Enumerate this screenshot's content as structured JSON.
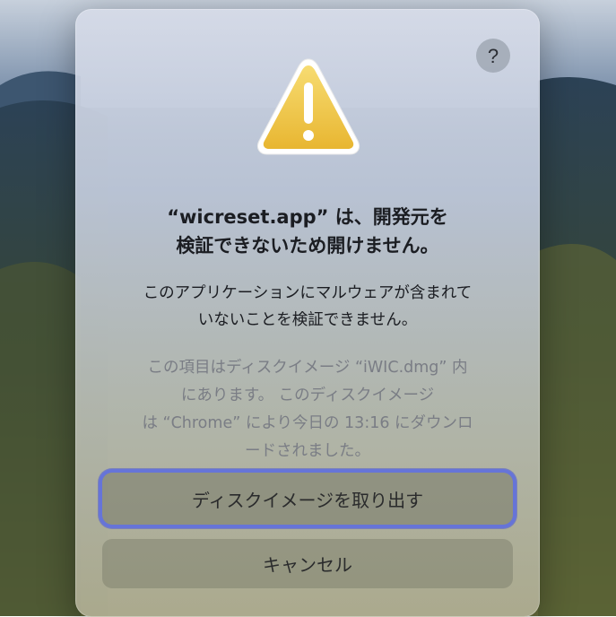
{
  "dialog": {
    "help_label": "?",
    "title_line1": "“wicreset.app” は、開発元を",
    "title_line2": "検証できないため開けません。",
    "message_line1": "このアプリケーションにマルウェアが含まれて",
    "message_line2": "いないことを検証できません。",
    "info_line1": "この項目はディスクイメージ “iWIC.dmg” 内",
    "info_line2": "にあります。 このディスクイメージ",
    "info_line3": "は “Chrome” により今日の 13:16 にダウンロ",
    "info_line4": "ードされました。",
    "primary_button_label": "ディスクイメージを取り出す",
    "cancel_button_label": "キャンセル",
    "icon": "warning-triangle-icon"
  },
  "colors": {
    "focus_ring": "#6674d8",
    "warning_yellow": "#f2c94a"
  }
}
